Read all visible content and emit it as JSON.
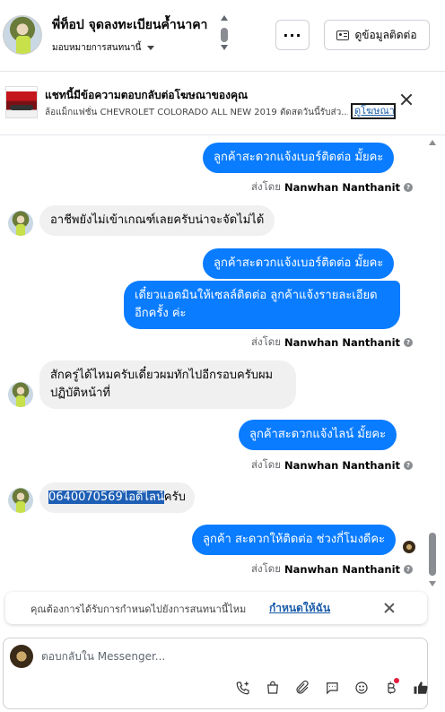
{
  "header": {
    "contact_name": "พี่ท็อป จุดลงทะเบียนค้ำนาคา",
    "assign_label": "มอบหมายการสนทนานี้",
    "more_label": "···",
    "contact_info_label": "ดูข้อมูลติดต่อ"
  },
  "ad": {
    "title": "แชทนี้มีข้อความตอบกลับต่อโฆษณาของคุณ",
    "subtitle": "ล้อแม็กแฟชั่น CHEVROLET COLORADO ALL NEW 2019 ตัดสดวันนี้รับส่ว...",
    "view_ad_label": "ดูโฆษณา"
  },
  "messages": [
    {
      "dir": "out",
      "text": "ลูกค้าสะดวกแจ้งเบอร์ติดต่อ มั้ยคะ"
    },
    {
      "sent_by_prefix": "ส่งโดย",
      "sent_by_name": "Nanwhan Nanthanit"
    },
    {
      "dir": "in",
      "text": "อาชีพยังไม่เข้าเกณฑ์เลยครับน่าจะจัดไม่ได้"
    },
    {
      "dir": "out",
      "text": "ลูกค้าสะดวกแจ้งเบอร์ติดต่อ มั้ยคะ"
    },
    {
      "dir": "out",
      "text_line1": "เดี๋ยวแอดมินให้เซลล์ติดต่อ ลูกค้าแจ้งรายละเอียด",
      "text_line2": "อีกครั้ง ค่ะ"
    },
    {
      "sent_by_prefix": "ส่งโดย",
      "sent_by_name": "Nanwhan Nanthanit"
    },
    {
      "dir": "in",
      "text_line1": "สักครู่ได้ไหมครับเดี๋ยวผมทักไปอีกรอบครับผม",
      "text_line2": "ปฏิบัติหน้าที่"
    },
    {
      "dir": "out",
      "text": "ลูกค้าสะดวกแจ้งไลน์ มั้ยคะ"
    },
    {
      "sent_by_prefix": "ส่งโดย",
      "sent_by_name": "Nanwhan Nanthanit"
    },
    {
      "dir": "in",
      "text_highlight": "0640070569ไอดีไลน์",
      "text_rest": "ครับ"
    },
    {
      "dir": "out",
      "text": "ลูกค้า สะดวกให้ติดต่อ ช่วงกี่โมงดีคะ"
    },
    {
      "sent_by_prefix": "ส่งโดย",
      "sent_by_name": "Nanwhan Nanthanit"
    }
  ],
  "notice": {
    "text": "คุณต้องการได้รับการกำหนดไปยังการสนทนานี้ไหม",
    "link": "กำหนดให้ฉัน"
  },
  "composer": {
    "placeholder": "ตอบกลับใน Messenger..."
  },
  "colors": {
    "outgoing_bubble": "#0a7cff",
    "incoming_bubble": "#f0f0f0",
    "link": "#1a5ca8"
  }
}
